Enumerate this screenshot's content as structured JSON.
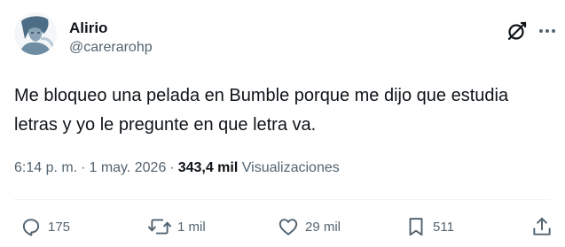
{
  "author": {
    "name": "Alirio",
    "handle": "@carerarohp",
    "avatar_icon": "profile-photo"
  },
  "post": {
    "text": "Me bloqueo una pelada en Bumble porque me dijo que estudia letras y yo le pregunte en que letra va."
  },
  "meta": {
    "time": "6:14 p. m.",
    "date": "1 may. 2026",
    "views_count": "343,4 mil",
    "views_label": "Visualizaciones"
  },
  "actions": {
    "replies": "175",
    "reposts": "1 mil",
    "likes": "29 mil",
    "bookmarks": "511"
  },
  "colors": {
    "text": "#0f1419",
    "secondary": "#536471",
    "divider": "#eff3f4"
  },
  "icons": {
    "reply": "reply-bubble-icon",
    "repost": "repost-arrows-icon",
    "like": "heart-icon",
    "bookmark": "bookmark-icon",
    "share": "share-upload-icon",
    "grok": "grok-icon",
    "more": "more-dots-icon"
  }
}
